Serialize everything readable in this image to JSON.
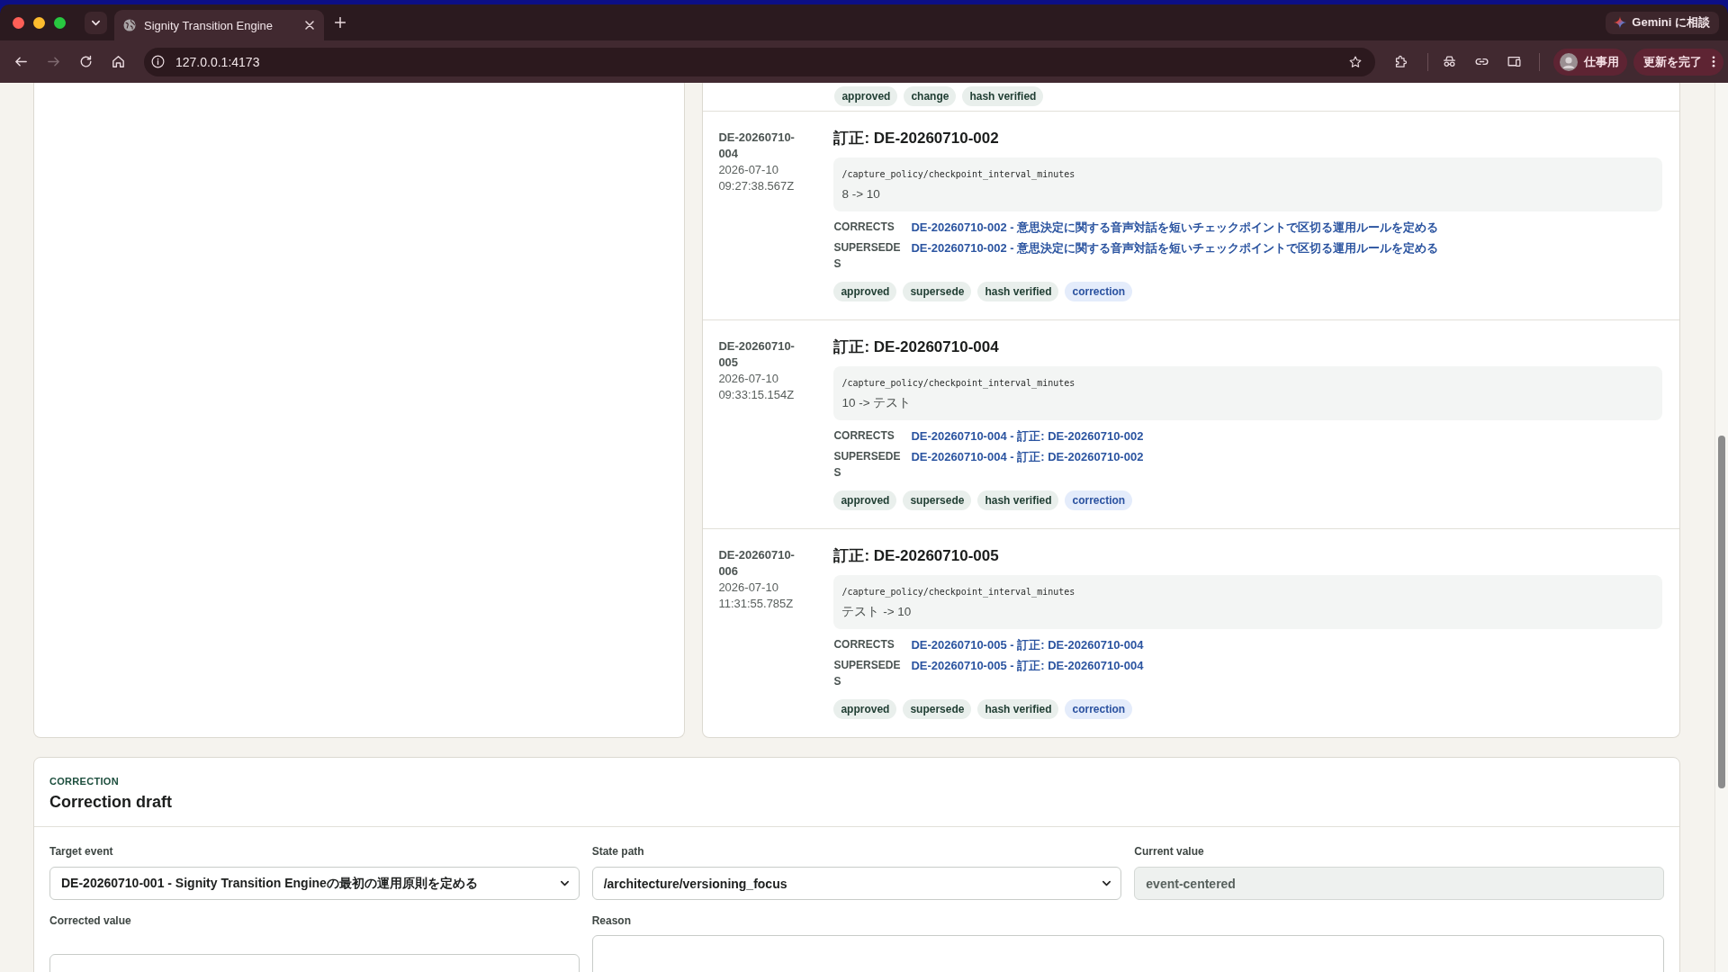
{
  "browser": {
    "tab": {
      "title": "Signity Transition Engine",
      "selected": true
    },
    "toolbar": {
      "forward_disabled": true,
      "address": "127.0.0.1:4173"
    },
    "gemini_button": "Gemini に相談",
    "profile_button": "仕事用",
    "update_button": "更新を完了"
  },
  "timeline": {
    "partial_tags": [
      {
        "label": "approved",
        "kind": "plain"
      },
      {
        "label": "change",
        "kind": "plain"
      },
      {
        "label": "hash verified",
        "kind": "plain"
      }
    ],
    "events": [
      {
        "id": "DE-20260710-004",
        "date": "2026-07-10",
        "time": "09:27:38.567Z",
        "title": "訂正: DE-20260710-002",
        "path": "/capture_policy/checkpoint_interval_minutes",
        "diff": "8 -> 10",
        "relations": [
          {
            "label": "CORRECTS",
            "link": "DE-20260710-002 - 意思決定に関する音声対話を短いチェックポイントで区切る運用ルールを定める"
          },
          {
            "label": "SUPERSEDES",
            "link": "DE-20260710-002 - 意思決定に関する音声対話を短いチェックポイントで区切る運用ルールを定める"
          }
        ],
        "tags": [
          {
            "label": "approved",
            "kind": "plain"
          },
          {
            "label": "supersede",
            "kind": "plain"
          },
          {
            "label": "hash verified",
            "kind": "plain"
          },
          {
            "label": "correction",
            "kind": "correction"
          }
        ]
      },
      {
        "id": "DE-20260710-005",
        "date": "2026-07-10",
        "time": "09:33:15.154Z",
        "title": "訂正: DE-20260710-004",
        "path": "/capture_policy/checkpoint_interval_minutes",
        "diff": "10 -> テスト",
        "relations": [
          {
            "label": "CORRECTS",
            "link": "DE-20260710-004 - 訂正: DE-20260710-002"
          },
          {
            "label": "SUPERSEDES",
            "link": "DE-20260710-004 - 訂正: DE-20260710-002"
          }
        ],
        "tags": [
          {
            "label": "approved",
            "kind": "plain"
          },
          {
            "label": "supersede",
            "kind": "plain"
          },
          {
            "label": "hash verified",
            "kind": "plain"
          },
          {
            "label": "correction",
            "kind": "correction"
          }
        ]
      },
      {
        "id": "DE-20260710-006",
        "date": "2026-07-10",
        "time": "11:31:55.785Z",
        "title": "訂正: DE-20260710-005",
        "path": "/capture_policy/checkpoint_interval_minutes",
        "diff": "テスト -> 10",
        "relations": [
          {
            "label": "CORRECTS",
            "link": "DE-20260710-005 - 訂正: DE-20260710-004"
          },
          {
            "label": "SUPERSEDES",
            "link": "DE-20260710-005 - 訂正: DE-20260710-004"
          }
        ],
        "tags": [
          {
            "label": "approved",
            "kind": "plain"
          },
          {
            "label": "supersede",
            "kind": "plain"
          },
          {
            "label": "hash verified",
            "kind": "plain"
          },
          {
            "label": "correction",
            "kind": "correction"
          }
        ]
      }
    ]
  },
  "correction": {
    "eyebrow": "CORRECTION",
    "title": "Correction draft",
    "fields": [
      {
        "label": "Target event",
        "kind": "select",
        "value": "DE-20260710-001 - Signity Transition Engineの最初の運用原則を定める"
      },
      {
        "label": "State path",
        "kind": "select",
        "value": "/architecture/versioning_focus"
      },
      {
        "label": "Current value",
        "kind": "readonly",
        "value": "event-centered"
      },
      {
        "label": "Corrected value",
        "kind": "input"
      },
      {
        "label": "Reason",
        "kind": "textarea"
      }
    ]
  }
}
